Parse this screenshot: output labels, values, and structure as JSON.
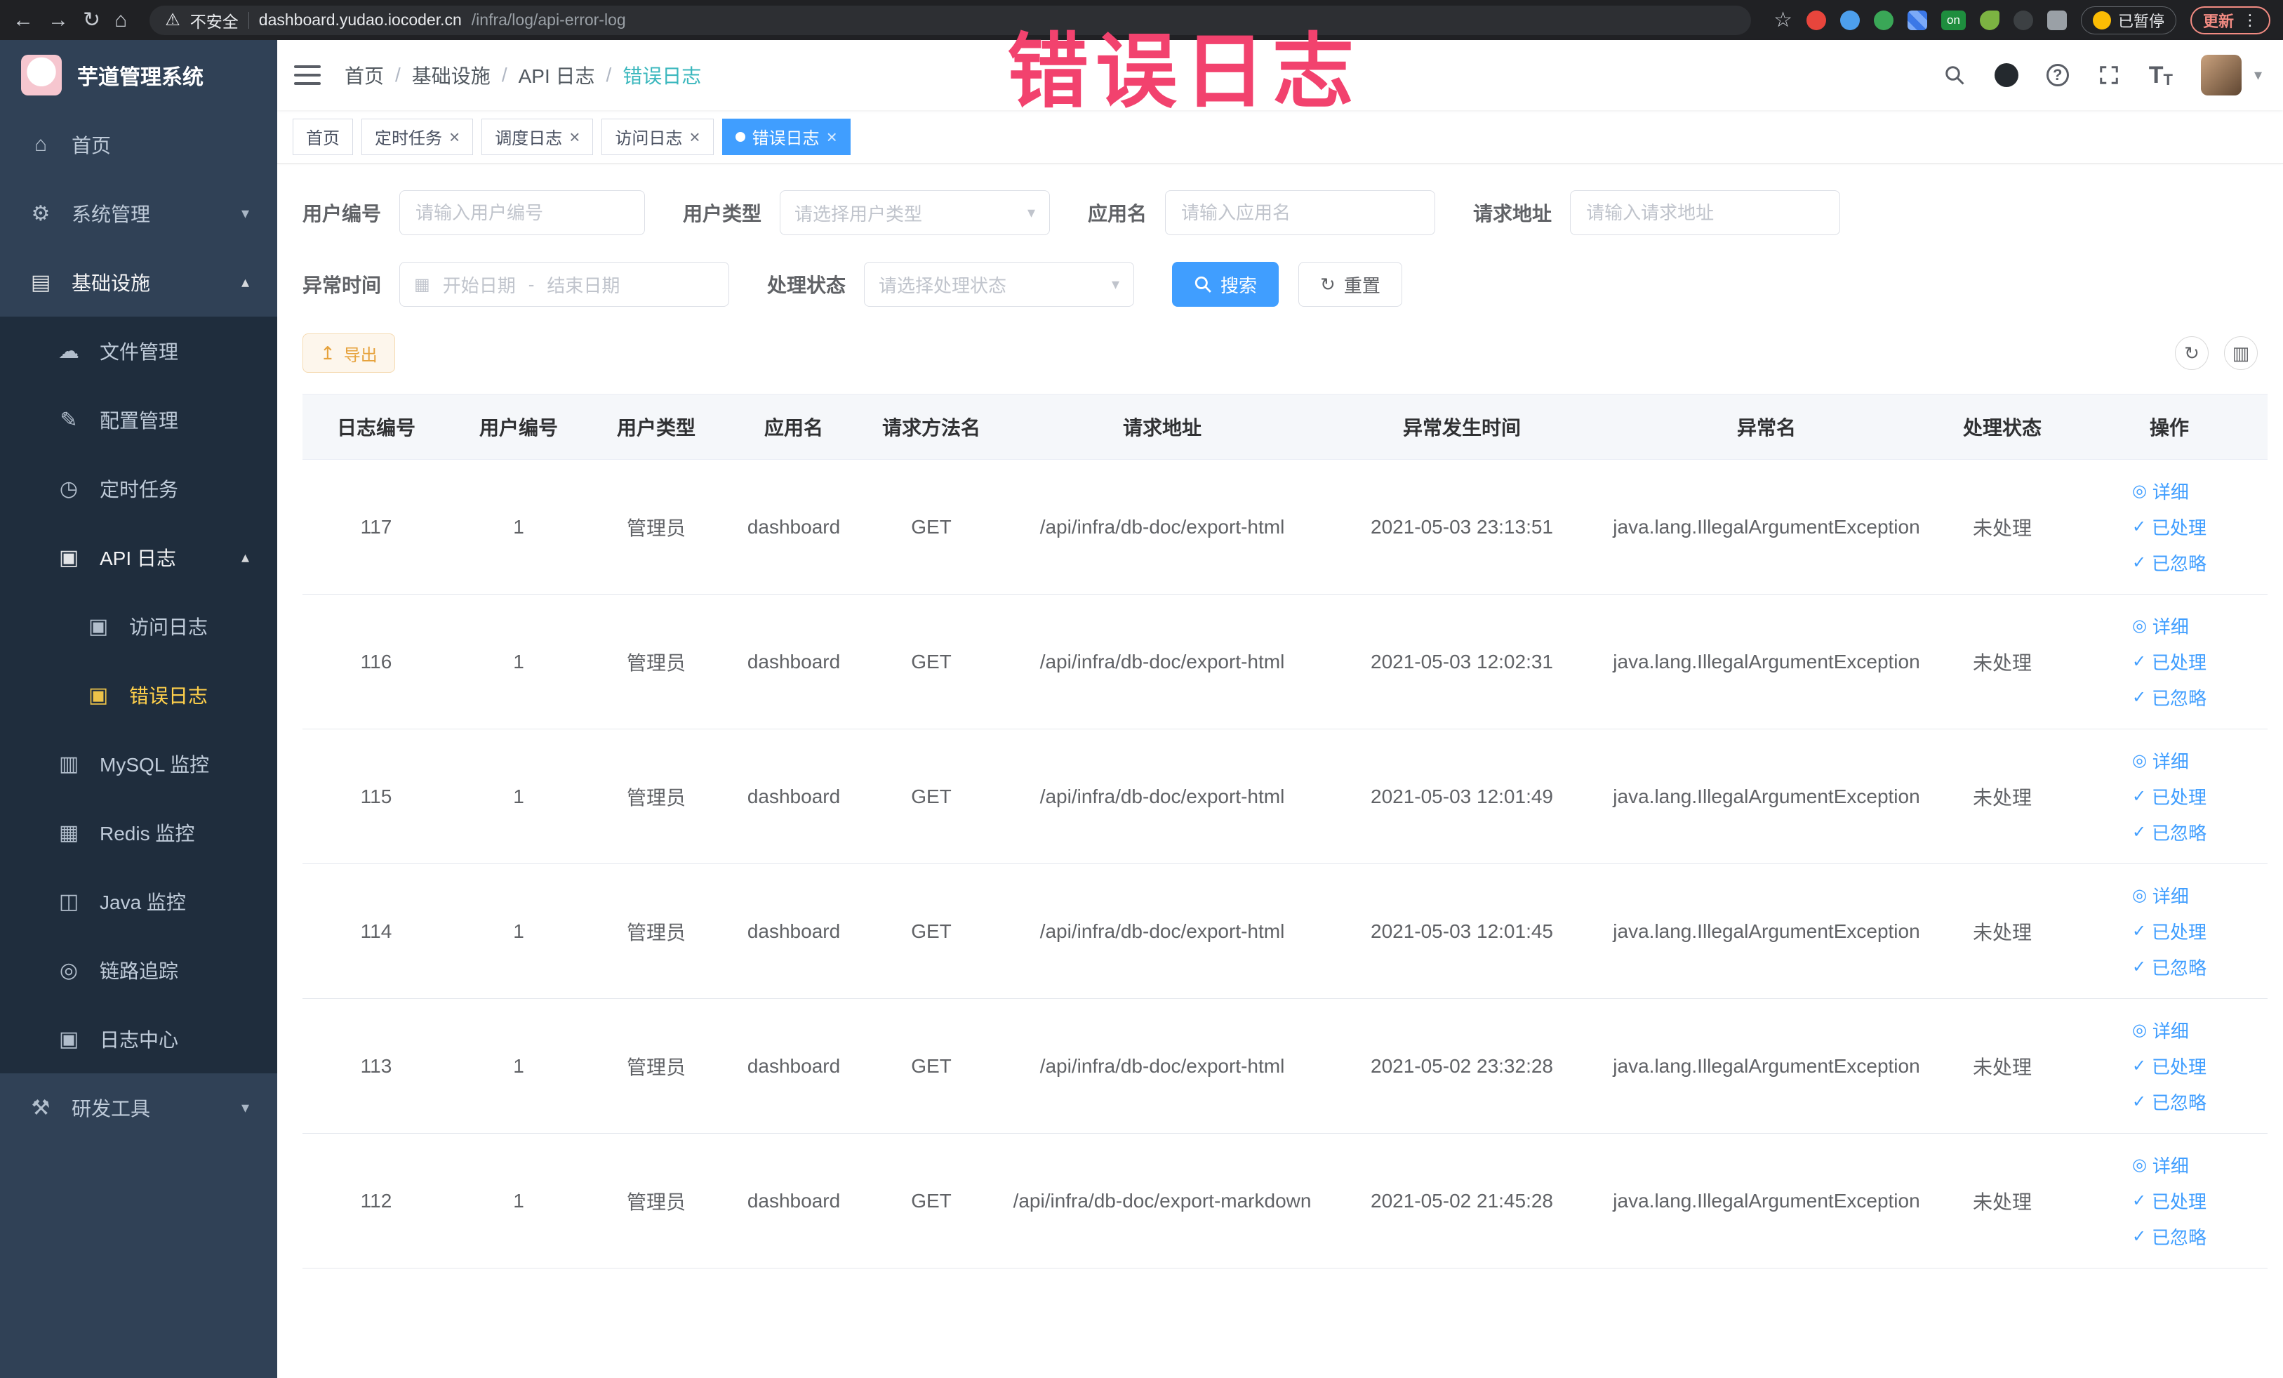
{
  "colors": {
    "accent": "#409eff",
    "link": "#409eff",
    "chrome_bg": "#202124",
    "sidebar_bg": "#304156",
    "submenu_bg": "#1f2d3d",
    "sidebar_text": "#bfcbd9",
    "sidebar_active": "#ffd04b",
    "breadcrumb_active": "#3ab7bd",
    "warning_btn_bg": "#fdf6ec",
    "warning_btn_border": "#f5dab1",
    "warning_btn_text": "#e6a23c",
    "annotation": "#f2426e"
  },
  "icons": {
    "back": "←",
    "forward": "→",
    "refresh": "↻",
    "house": "⌂",
    "star": "☆",
    "warning": "⚠",
    "kebab": "⋮",
    "close": "×",
    "chevdown": "▾",
    "chevup": "▴",
    "calendar": "▦",
    "export": "↥",
    "columns": "▥",
    "view": "◎",
    "check": "✓",
    "home": "⌂",
    "gear": "⚙",
    "monitor": "▤",
    "cloud": "☁",
    "edit": "✎",
    "clock": "◷",
    "doc": "▣",
    "db": "▥",
    "layers": "▦",
    "screen": "◫",
    "eye": "◎",
    "tools": "⚒",
    "question": "?"
  },
  "annotation": {
    "text": "错误日志"
  },
  "browser": {
    "security_label": "不安全",
    "url_host": "dashboard.yudao.iocoder.cn",
    "url_path": "/infra/log/api-error-log",
    "extension_on_label": "on",
    "paused_label": "已暂停",
    "update_label": "更新"
  },
  "sidebar": {
    "title": "芋道管理系统",
    "items": [
      {
        "key": "home",
        "icon": "home",
        "label": "首页",
        "type": "top"
      },
      {
        "key": "system",
        "icon": "gear",
        "label": "系统管理",
        "type": "top",
        "expandable": true,
        "expanded": false
      },
      {
        "key": "infra",
        "icon": "monitor",
        "label": "基础设施",
        "type": "top",
        "expandable": true,
        "expanded": true,
        "open": true
      },
      {
        "key": "file",
        "icon": "cloud",
        "label": "文件管理",
        "type": "sub"
      },
      {
        "key": "config",
        "icon": "edit",
        "label": "配置管理",
        "type": "sub"
      },
      {
        "key": "cron",
        "icon": "clock",
        "label": "定时任务",
        "type": "sub"
      },
      {
        "key": "api-log",
        "icon": "doc",
        "label": "API 日志",
        "type": "sub",
        "expandable": true,
        "expanded": true,
        "open": true
      },
      {
        "key": "access-log",
        "icon": "doc",
        "label": "访问日志",
        "type": "subsub"
      },
      {
        "key": "error-log",
        "icon": "doc",
        "label": "错误日志",
        "type": "subsub",
        "active": true
      },
      {
        "key": "mysql",
        "icon": "db",
        "label": "MySQL 监控",
        "type": "sub"
      },
      {
        "key": "redis",
        "icon": "layers",
        "label": "Redis 监控",
        "type": "sub"
      },
      {
        "key": "java",
        "icon": "screen",
        "label": "Java 监控",
        "type": "sub"
      },
      {
        "key": "trace",
        "icon": "eye",
        "label": "链路追踪",
        "type": "sub"
      },
      {
        "key": "log-center",
        "icon": "doc",
        "label": "日志中心",
        "type": "sub"
      },
      {
        "key": "devtools",
        "icon": "tools",
        "label": "研发工具",
        "type": "top",
        "expandable": true,
        "expanded": false
      }
    ]
  },
  "header": {
    "breadcrumb": [
      "首页",
      "基础设施",
      "API 日志",
      "错误日志"
    ]
  },
  "tabs": [
    {
      "key": "home",
      "label": "首页",
      "closable": false,
      "active": false
    },
    {
      "key": "cron",
      "label": "定时任务",
      "closable": true,
      "active": false
    },
    {
      "key": "job-log",
      "label": "调度日志",
      "closable": true,
      "active": false
    },
    {
      "key": "access-log",
      "label": "访问日志",
      "closable": true,
      "active": false
    },
    {
      "key": "error-log",
      "label": "错误日志",
      "closable": true,
      "active": true
    }
  ],
  "filters": {
    "user_id": {
      "label": "用户编号",
      "placeholder": "请输入用户编号"
    },
    "user_type": {
      "label": "用户类型",
      "placeholder": "请选择用户类型"
    },
    "app_name": {
      "label": "应用名",
      "placeholder": "请输入应用名"
    },
    "request_url": {
      "label": "请求地址",
      "placeholder": "请输入请求地址"
    },
    "exception_time": {
      "label": "异常时间",
      "start_placeholder": "开始日期",
      "separator": "-",
      "end_placeholder": "结束日期"
    },
    "process_status": {
      "label": "处理状态",
      "placeholder": "请选择处理状态"
    },
    "search_label": "搜索",
    "reset_label": "重置"
  },
  "toolbar": {
    "export_label": "导出"
  },
  "table": {
    "columns": [
      "日志编号",
      "用户编号",
      "用户类型",
      "应用名",
      "请求方法名",
      "请求地址",
      "异常发生时间",
      "异常名",
      "处理状态",
      "操作"
    ],
    "actions": [
      "详细",
      "已处理",
      "已忽略"
    ],
    "rows": [
      {
        "id": "117",
        "user_id": "1",
        "user_type": "管理员",
        "app": "dashboard",
        "method": "GET",
        "url": "/api/infra/db-doc/export-html",
        "time": "2021-05-03 23:13:51",
        "exception": "java.lang.IllegalArgumentException",
        "status": "未处理"
      },
      {
        "id": "116",
        "user_id": "1",
        "user_type": "管理员",
        "app": "dashboard",
        "method": "GET",
        "url": "/api/infra/db-doc/export-html",
        "time": "2021-05-03 12:02:31",
        "exception": "java.lang.IllegalArgumentException",
        "status": "未处理"
      },
      {
        "id": "115",
        "user_id": "1",
        "user_type": "管理员",
        "app": "dashboard",
        "method": "GET",
        "url": "/api/infra/db-doc/export-html",
        "time": "2021-05-03 12:01:49",
        "exception": "java.lang.IllegalArgumentException",
        "status": "未处理"
      },
      {
        "id": "114",
        "user_id": "1",
        "user_type": "管理员",
        "app": "dashboard",
        "method": "GET",
        "url": "/api/infra/db-doc/export-html",
        "time": "2021-05-03 12:01:45",
        "exception": "java.lang.IllegalArgumentException",
        "status": "未处理"
      },
      {
        "id": "113",
        "user_id": "1",
        "user_type": "管理员",
        "app": "dashboard",
        "method": "GET",
        "url": "/api/infra/db-doc/export-html",
        "time": "2021-05-02 23:32:28",
        "exception": "java.lang.IllegalArgumentException",
        "status": "未处理"
      },
      {
        "id": "112",
        "user_id": "1",
        "user_type": "管理员",
        "app": "dashboard",
        "method": "GET",
        "url": "/api/infra/db-doc/export-markdown",
        "time": "2021-05-02 21:45:28",
        "exception": "java.lang.IllegalArgumentException",
        "status": "未处理"
      }
    ]
  }
}
